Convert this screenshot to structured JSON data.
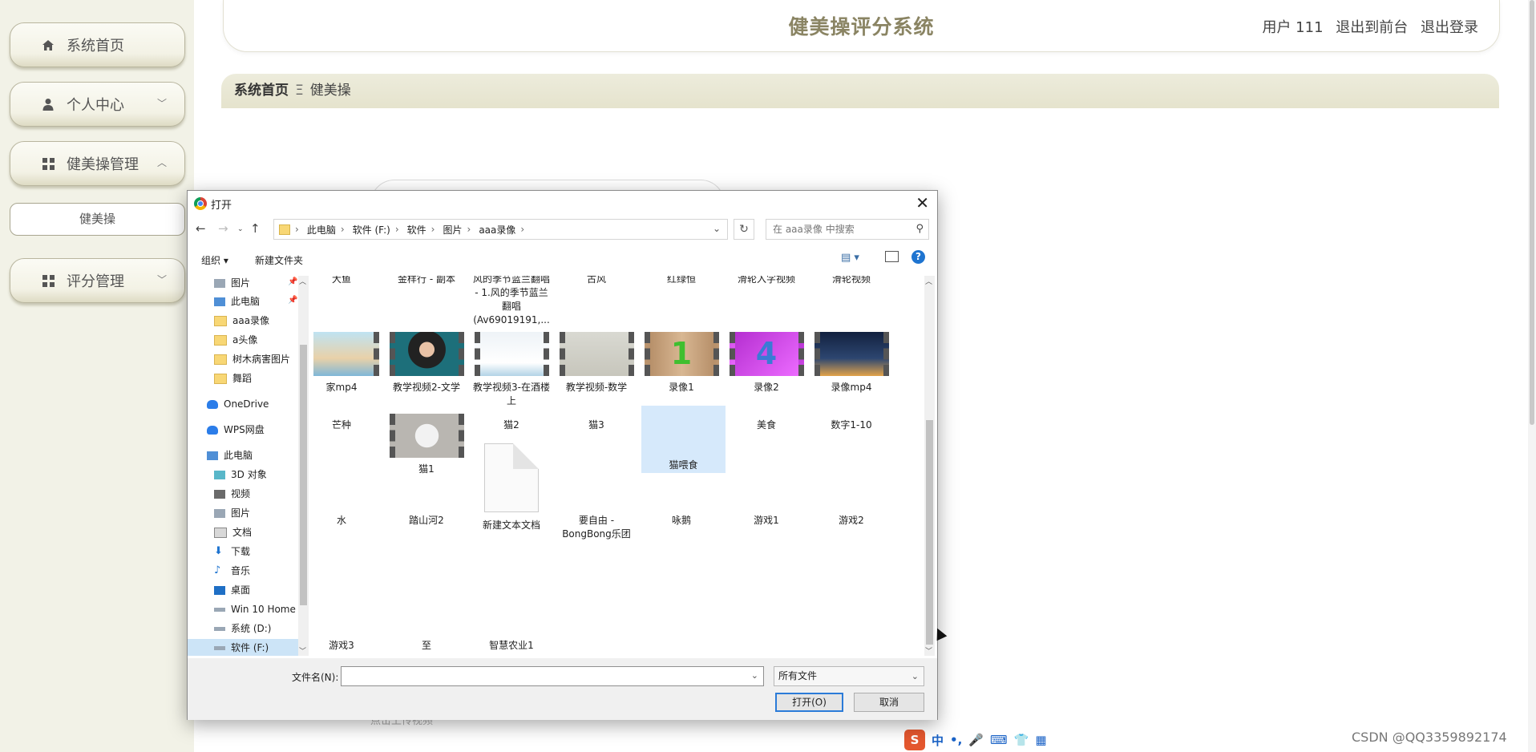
{
  "app": {
    "title": "健美操评分系统"
  },
  "header": {
    "user": "用户 111",
    "back_front": "退出到前台",
    "logout": "退出登录"
  },
  "sidebar": {
    "home": "系统首页",
    "personal": "个人中心",
    "aerobics_mgmt": "健美操管理",
    "aerobics_sub": "健美操",
    "score_mgmt": "评分管理"
  },
  "breadcrumb": {
    "home": "系统首页",
    "sep": "Ξ",
    "current": "健美操"
  },
  "ghost_text": "点击上传视频",
  "watermark": "CSDN @QQ3359892174",
  "ime": {
    "logo": "S",
    "lang": "中",
    "punct": "•,",
    "mic": "🎤",
    "kb": "⌨",
    "shirt": "👕",
    "grid": "▦"
  },
  "dialog": {
    "title": "打开",
    "path": [
      "此电脑",
      "软件 (F:)",
      "软件",
      "图片",
      "aaa录像"
    ],
    "search_placeholder": "在 aaa录像 中搜索",
    "organize": "组织 ▾",
    "new_folder": "新建文件夹",
    "nav_items": {
      "pictures_q": "图片",
      "thispc_q": "此电脑",
      "aaa": "aaa录像",
      "a_avatar": "a头像",
      "tree": "树木病害图片",
      "dance": "舞蹈",
      "onedrive": "OneDrive",
      "wps": "WPS网盘",
      "thispc": "此电脑",
      "obj3d": "3D 对象",
      "video": "视频",
      "pictures": "图片",
      "docs": "文档",
      "downloads": "下载",
      "music": "音乐",
      "desktop": "桌面",
      "win10": "Win 10 Home ›",
      "sysd": "系统 (D:)",
      "softf": "软件 (F:)"
    },
    "files_row0": [
      "大鱼",
      "金样行 - 副本",
      "风的季节蓝兰翻唱 - 1.风的季节蓝兰翻唱(Av69019191,...",
      "古风",
      "红绿恒",
      "滑轮入字视频",
      "滑轮视频"
    ],
    "files_row1": [
      "家mp4",
      "教学视频2-文学",
      "教学视频3-在酒楼上",
      "教学视频-数学",
      "录像1",
      "录像2",
      "录像mp4"
    ],
    "files_row2": [
      "芒种",
      "猫1",
      "猫2",
      "猫3",
      "猫喂食",
      "美食",
      "数字1-10"
    ],
    "files_row3": [
      "水",
      "踏山河2",
      "新建文本文档",
      "要自由 - BongBong乐团",
      "咏鹅",
      "游戏1",
      "游戏2"
    ],
    "files_row4": [
      "游戏3",
      "至",
      "智慧农业1"
    ],
    "filename_label": "文件名(N):",
    "filename_value": "",
    "filetype": "所有文件",
    "open_btn": "打开(O)",
    "cancel_btn": "取消"
  }
}
